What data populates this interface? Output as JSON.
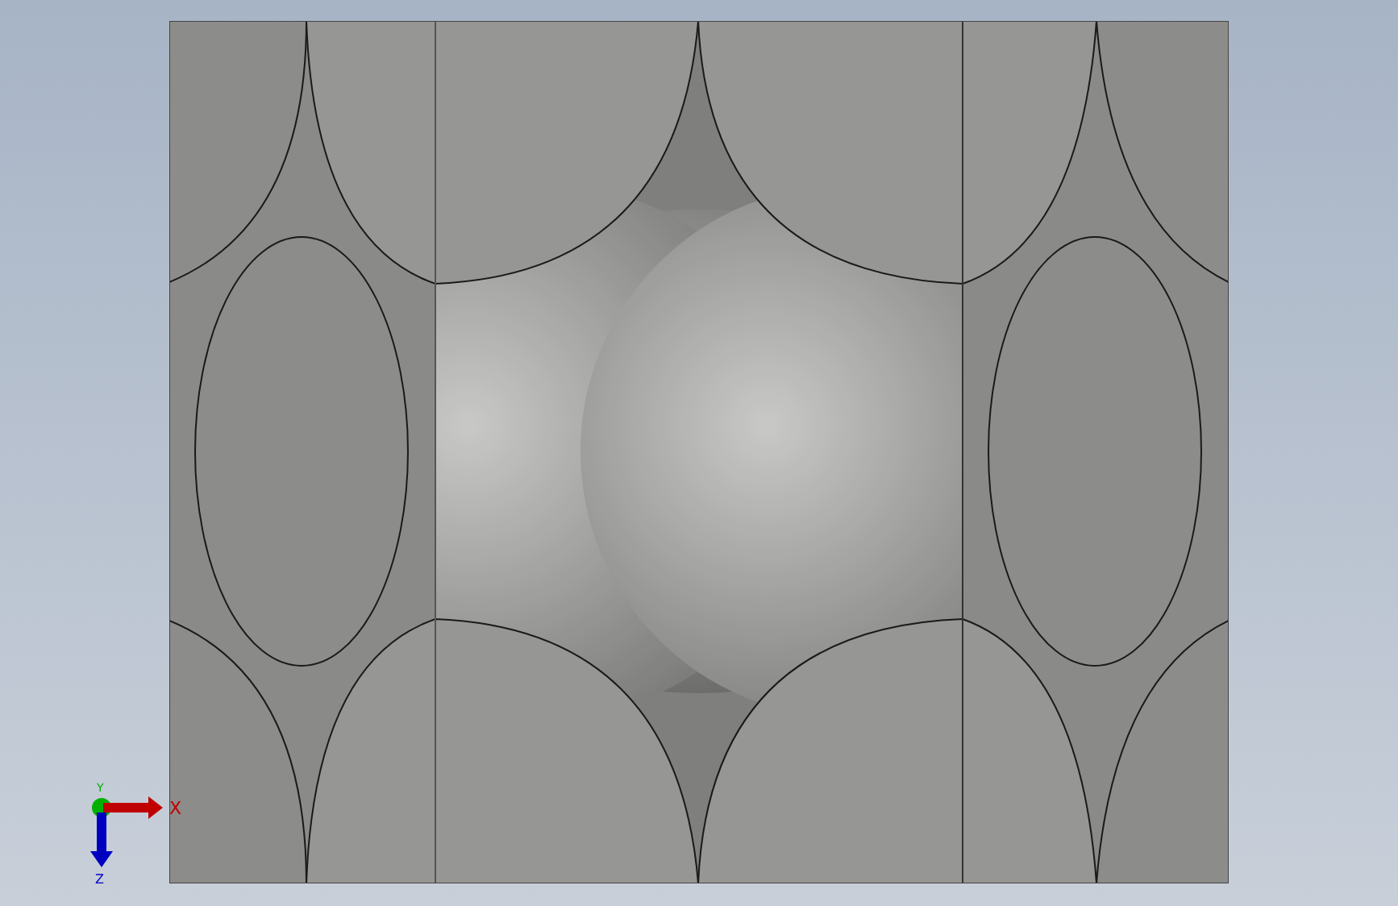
{
  "viewport": {
    "triad": {
      "axes": [
        {
          "kind": "y",
          "label": "Y",
          "color": "#00b000"
        },
        {
          "kind": "x",
          "label": "X",
          "color": "#c00000"
        },
        {
          "kind": "z",
          "label": "Z",
          "color": "#0000c0"
        }
      ]
    }
  }
}
